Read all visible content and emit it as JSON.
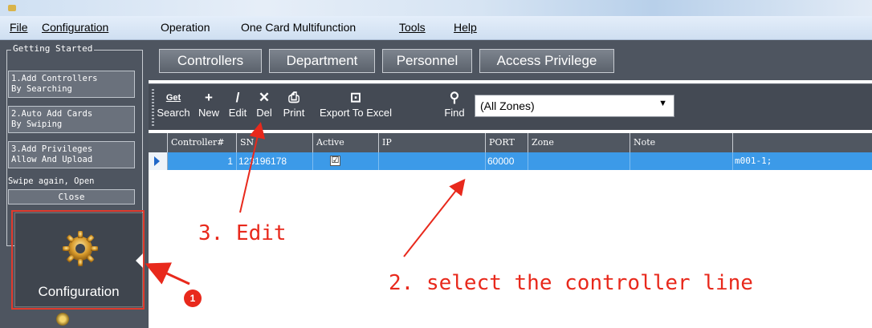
{
  "menu": {
    "file": "File",
    "configuration": "Configuration",
    "operation": "Operation",
    "one_card": "One Card Multifunction",
    "tools": "Tools",
    "help": "Help"
  },
  "left_panel": {
    "getting_started": "Getting Started",
    "steps": [
      {
        "line1": "1.Add Controllers",
        "line2": "By Searching"
      },
      {
        "line1": "2.Auto Add Cards",
        "line2": "By Swiping"
      },
      {
        "line1": "3.Add Privileges",
        "line2": "Allow And Upload"
      }
    ],
    "swipe_text": "Swipe again, Open",
    "close": "Close",
    "config_tile": "Configuration"
  },
  "tabs": [
    "Controllers",
    "Department",
    "Personnel",
    "Access Privilege"
  ],
  "toolbar": {
    "search": "Search",
    "new": "New",
    "edit": "Edit",
    "del": "Del",
    "print": "Print",
    "export": "Export To Excel",
    "find": "Find",
    "zone_value": "(All Zones)",
    "get_label": "Get"
  },
  "grid": {
    "columns": [
      "Controller#",
      "SN",
      "Active",
      "IP",
      "PORT",
      "Zone",
      "Note",
      ""
    ],
    "rows": [
      {
        "controller": "1",
        "sn": "123196178",
        "active": "☑",
        "ip": "",
        "port": "60000",
        "zone": "",
        "note": "",
        "extra": "m001-1;"
      }
    ]
  },
  "annotations": {
    "edit": "3. Edit",
    "select": "2. select the controller line",
    "badge": "1"
  },
  "colors": {
    "panel": "#4e5560",
    "selected_row": "#3c9ae8",
    "annotation": "#e8291c"
  }
}
